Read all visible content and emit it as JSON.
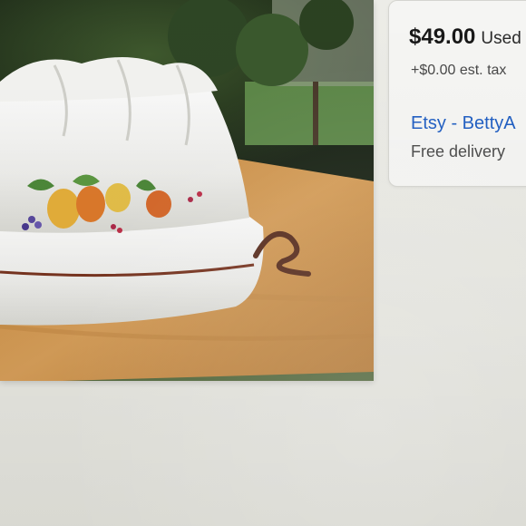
{
  "listing": {
    "photo_icon": "jello-mold-product-photo"
  },
  "offer": {
    "price": "$49.00",
    "condition": "Used",
    "tax": "+$0.00 est. tax",
    "seller": "Etsy - BettyA",
    "delivery": "Free delivery"
  },
  "colors": {
    "link": "#1f5fc6",
    "price_text": "#191919",
    "secondary_text": "#4a4a4a",
    "card_border": "#d9d9d4"
  }
}
